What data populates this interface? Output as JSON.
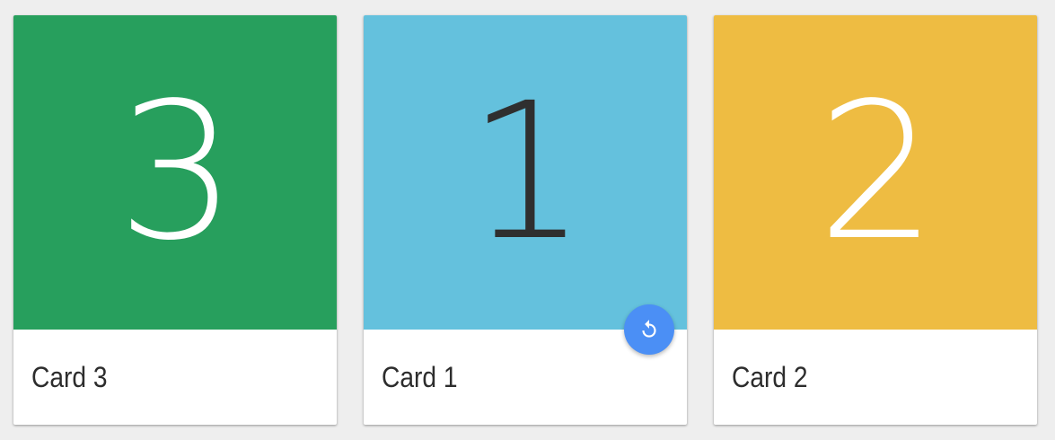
{
  "cards": [
    {
      "number": "3",
      "title": "Card 3",
      "color": "#279f5d",
      "number_color": "#ffffff"
    },
    {
      "number": "1",
      "title": "Card 1",
      "color": "#64c1dd",
      "number_color": "#2f2f2f",
      "action": {
        "icon": "undo-icon",
        "color": "#4b8ff5"
      }
    },
    {
      "number": "2",
      "title": "Card 2",
      "color": "#eebc42",
      "number_color": "#ffffff"
    }
  ]
}
